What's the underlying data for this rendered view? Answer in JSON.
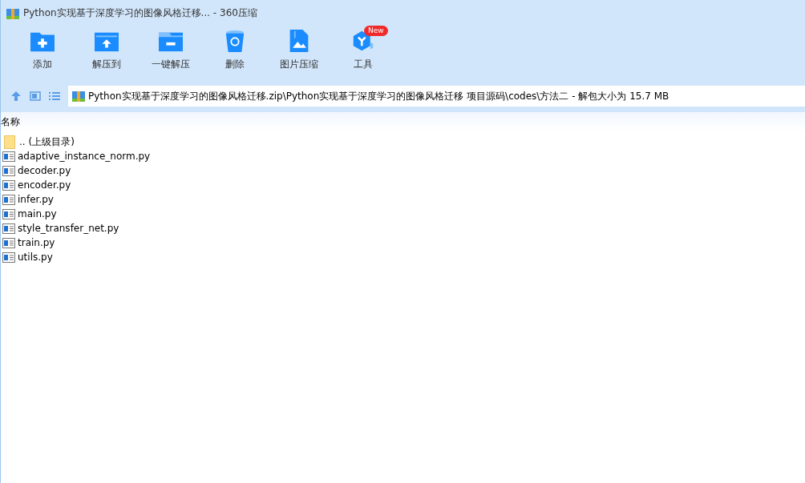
{
  "window": {
    "title": "Python实现基于深度学习的图像风格迁移... - 360压缩"
  },
  "toolbar": [
    {
      "label": "添加",
      "kind": "add"
    },
    {
      "label": "解压到",
      "kind": "extract"
    },
    {
      "label": "一键解压",
      "kind": "oneclick"
    },
    {
      "label": "删除",
      "kind": "delete"
    },
    {
      "label": "图片压缩",
      "kind": "image"
    },
    {
      "label": "工具",
      "kind": "tools",
      "badge": "New"
    }
  ],
  "address_bar": {
    "path": "Python实现基于深度学习的图像风格迁移.zip\\Python实现基于深度学习的图像风格迁移 项目源码\\codes\\方法二 - 解包大小为 15.7 MB"
  },
  "file_list": {
    "columns": [
      "名称"
    ],
    "rows": [
      {
        "name": ".. (上级目录)",
        "kind": "parent"
      },
      {
        "name": "adaptive_instance_norm.py",
        "kind": "file"
      },
      {
        "name": "decoder.py",
        "kind": "file"
      },
      {
        "name": "encoder.py",
        "kind": "file"
      },
      {
        "name": "infer.py",
        "kind": "file"
      },
      {
        "name": "main.py",
        "kind": "file"
      },
      {
        "name": "style_transfer_net.py",
        "kind": "file"
      },
      {
        "name": "train.py",
        "kind": "file"
      },
      {
        "name": "utils.py",
        "kind": "file"
      }
    ]
  }
}
